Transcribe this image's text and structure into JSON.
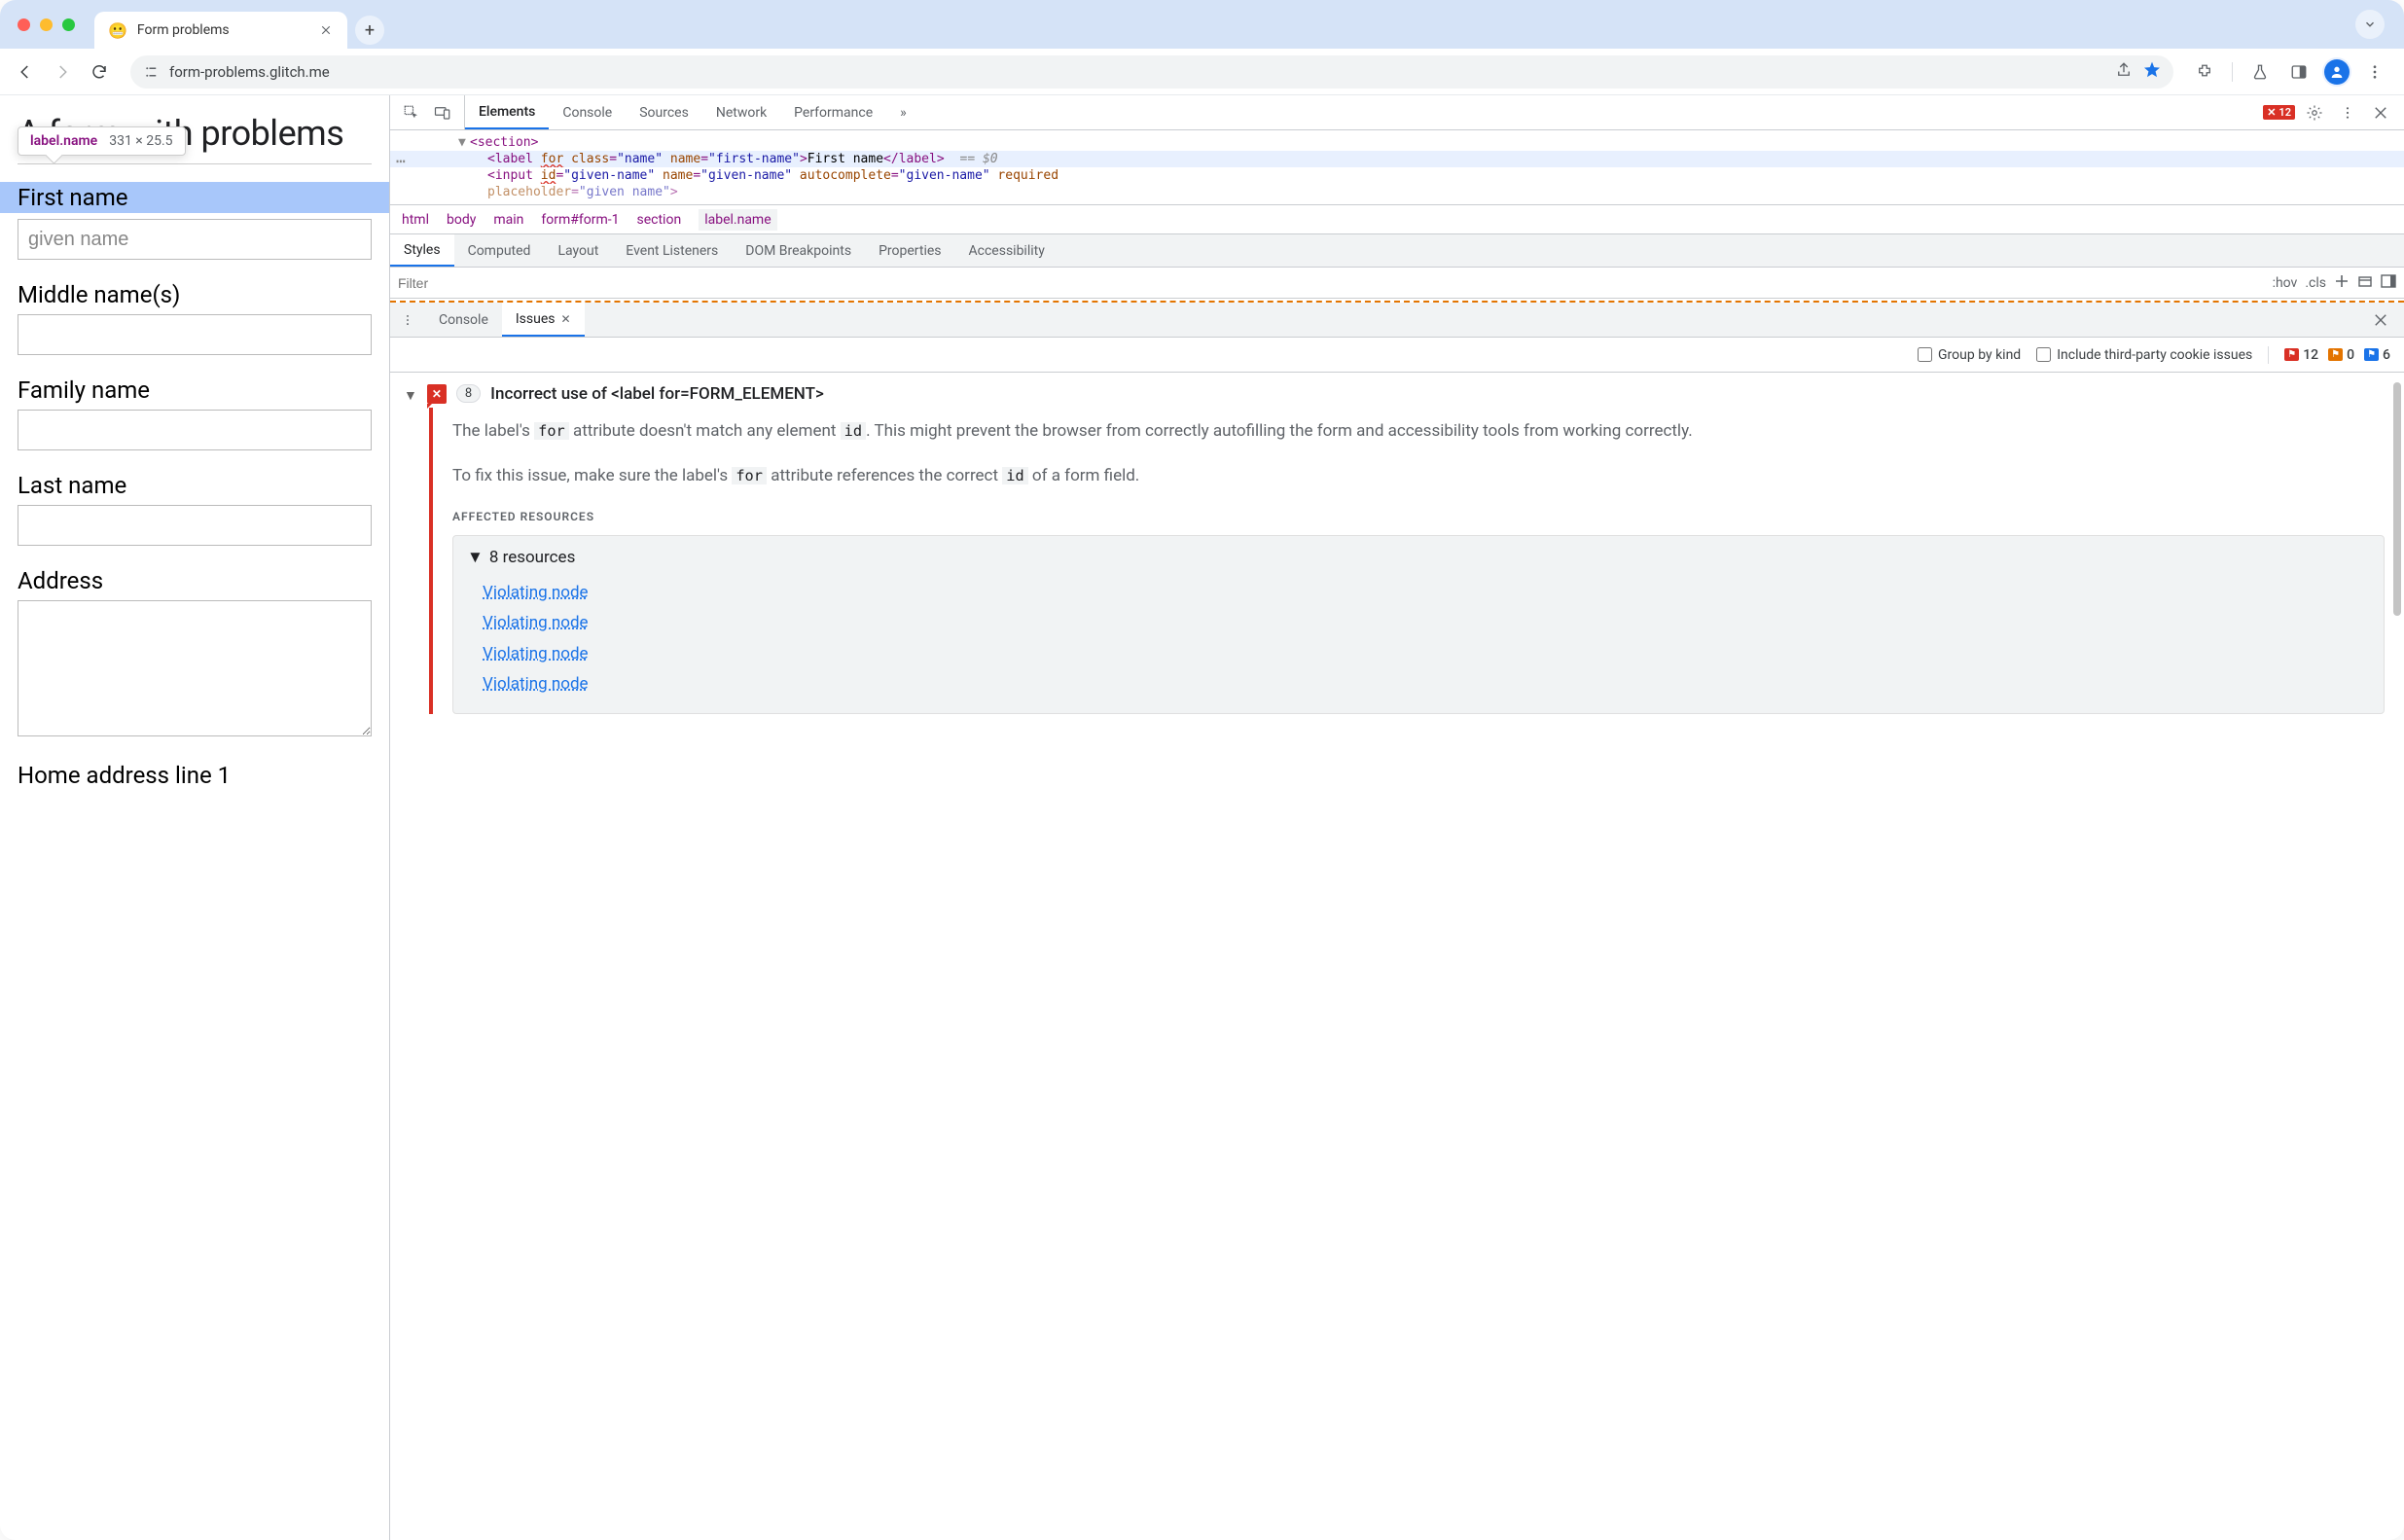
{
  "tab": {
    "favicon": "😬",
    "title": "Form problems"
  },
  "address": {
    "url": "form-problems.glitch.me"
  },
  "page": {
    "heading": "A form with problems",
    "tooltip_selector": "label.name",
    "tooltip_dims": "331 × 25.5",
    "fields": {
      "first_name": {
        "label": "First name",
        "placeholder": "given name"
      },
      "middle": {
        "label": "Middle name(s)"
      },
      "family": {
        "label": "Family name"
      },
      "last": {
        "label": "Last name"
      },
      "address": {
        "label": "Address"
      },
      "home1": {
        "label": "Home address line 1"
      }
    }
  },
  "devtools": {
    "tabs": [
      "Elements",
      "Console",
      "Sources",
      "Network",
      "Performance"
    ],
    "error_count": "12",
    "elements": {
      "line1_tag": "section",
      "line2": {
        "tag": "label",
        "for_attr": "for",
        "class_attr": "class",
        "class_val": "\"name\"",
        "name_attr": "name",
        "name_val": "\"first-name\"",
        "text": "First name",
        "eq": "== $0"
      },
      "line3": {
        "tag": "input",
        "id_attr": "id",
        "id_val": "\"given-name\"",
        "name_attr": "name",
        "name_val": "\"given-name\"",
        "ac_attr": "autocomplete",
        "ac_val": "\"given-name\"",
        "req": "required"
      },
      "line4": {
        "ph_attr": "placeholder",
        "ph_val": "\"given name\""
      }
    },
    "breadcrumbs": [
      "html",
      "body",
      "main",
      "form#form-1",
      "section",
      "label.name"
    ],
    "styles_tabs": [
      "Styles",
      "Computed",
      "Layout",
      "Event Listeners",
      "DOM Breakpoints",
      "Properties",
      "Accessibility"
    ],
    "styles_filter_placeholder": "Filter",
    "styles_actions": {
      "hov": ":hov",
      "cls": ".cls"
    },
    "drawer_tabs": {
      "console": "Console",
      "issues": "Issues"
    },
    "issues_toolbar": {
      "group_label": "Group by kind",
      "third_party_label": "Include third-party cookie issues",
      "red_count": "12",
      "orange_count": "0",
      "blue_count": "6"
    },
    "issue": {
      "count": "8",
      "title": "Incorrect use of <label for=FORM_ELEMENT>",
      "p1_a": "The label's ",
      "p1_code1": "for",
      "p1_b": " attribute doesn't match any element ",
      "p1_code2": "id",
      "p1_c": ". This might prevent the browser from correctly autofilling the form and accessibility tools from working correctly.",
      "p2_a": "To fix this issue, make sure the label's ",
      "p2_code1": "for",
      "p2_b": " attribute references the correct ",
      "p2_code2": "id",
      "p2_c": " of a form field.",
      "aff_res": "AFFECTED RESOURCES",
      "res_header": "8 resources",
      "link_text": "Violating node"
    }
  }
}
